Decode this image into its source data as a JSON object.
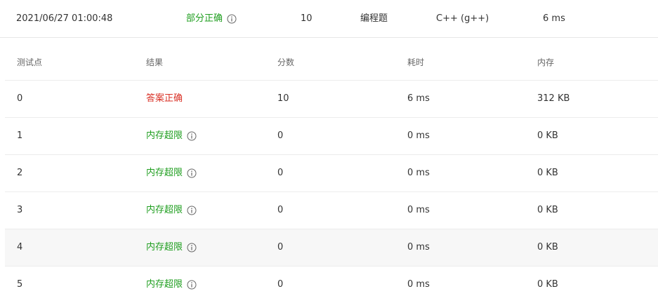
{
  "summary": {
    "submit_time": "2021/06/27 01:00:48",
    "status": "部分正确",
    "score": "10",
    "problem_type": "编程题",
    "language": "C++ (g++)",
    "time_cost": "6 ms",
    "status_color": "#1f9e1f"
  },
  "table": {
    "headers": {
      "case": "测试点",
      "result": "结果",
      "score": "分数",
      "time": "耗时",
      "memory": "内存"
    },
    "rows": [
      {
        "case": "0",
        "result": "答案正确",
        "result_type": "accepted",
        "score": "10",
        "time": "6 ms",
        "memory": "312 KB"
      },
      {
        "case": "1",
        "result": "内存超限",
        "result_type": "memory-limit",
        "score": "0",
        "time": "0 ms",
        "memory": "0 KB"
      },
      {
        "case": "2",
        "result": "内存超限",
        "result_type": "memory-limit",
        "score": "0",
        "time": "0 ms",
        "memory": "0 KB"
      },
      {
        "case": "3",
        "result": "内存超限",
        "result_type": "memory-limit",
        "score": "0",
        "time": "0 ms",
        "memory": "0 KB"
      },
      {
        "case": "4",
        "result": "内存超限",
        "result_type": "memory-limit",
        "score": "0",
        "time": "0 ms",
        "memory": "0 KB"
      },
      {
        "case": "5",
        "result": "内存超限",
        "result_type": "memory-limit",
        "score": "0",
        "time": "0 ms",
        "memory": "0 KB"
      }
    ]
  },
  "colors": {
    "accepted": "#d93025",
    "memory_limit": "#1f9e1f",
    "icon": "#666666"
  },
  "icons": {
    "status_info": "info-icon",
    "result_info": "info-icon"
  }
}
